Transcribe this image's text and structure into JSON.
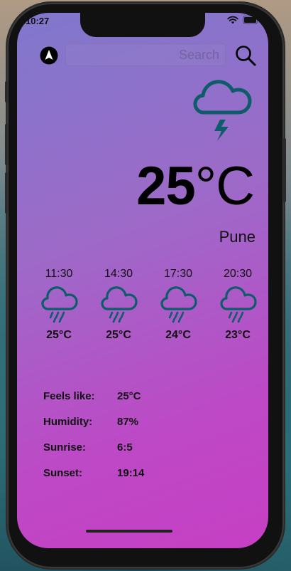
{
  "status_bar": {
    "time": "10:27"
  },
  "search": {
    "placeholder": "Search",
    "value": ""
  },
  "current": {
    "condition_icon": "cloud-lightning-icon",
    "temperature": "25",
    "unit": "°C",
    "city": "Pune"
  },
  "forecast": [
    {
      "time": "11:30",
      "icon": "cloud-rain-icon",
      "temp": "25°C"
    },
    {
      "time": "14:30",
      "icon": "cloud-rain-icon",
      "temp": "25°C"
    },
    {
      "time": "17:30",
      "icon": "cloud-rain-icon",
      "temp": "24°C"
    },
    {
      "time": "20:30",
      "icon": "cloud-rain-icon",
      "temp": "23°C"
    }
  ],
  "details": [
    {
      "label": "Feels like:",
      "value": "25°C"
    },
    {
      "label": "Humidity:",
      "value": "87%"
    },
    {
      "label": "Sunrise:",
      "value": "6:5"
    },
    {
      "label": "Sunset:",
      "value": "19:14"
    }
  ],
  "colors": {
    "icon_teal": "#0e5c6a",
    "gradient_start": "#7f78cc",
    "gradient_end": "#c63fc4"
  }
}
